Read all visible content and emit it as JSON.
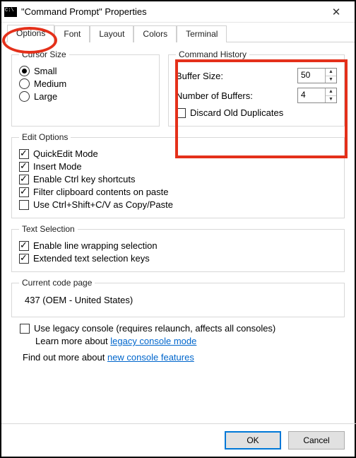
{
  "window": {
    "title": "\"Command Prompt\" Properties"
  },
  "tabs": {
    "options": "Options",
    "font": "Font",
    "layout": "Layout",
    "colors": "Colors",
    "terminal": "Terminal"
  },
  "cursor": {
    "legend": "Cursor Size",
    "small": "Small",
    "medium": "Medium",
    "large": "Large"
  },
  "history": {
    "legend": "Command History",
    "buffer_label": "Buffer Size:",
    "buffer_value": "50",
    "numbuf_label": "Number of Buffers:",
    "numbuf_value": "4",
    "discard_label": "Discard Old Duplicates"
  },
  "edit": {
    "legend": "Edit Options",
    "quickedit": "QuickEdit Mode",
    "insert": "Insert Mode",
    "ctrlkeys": "Enable Ctrl key shortcuts",
    "filter": "Filter clipboard contents on paste",
    "ctrlshift": "Use Ctrl+Shift+C/V as Copy/Paste"
  },
  "textsel": {
    "legend": "Text Selection",
    "wrap": "Enable line wrapping selection",
    "extended": "Extended text selection keys"
  },
  "codepage": {
    "legend": "Current code page",
    "value": "437   (OEM - United States)"
  },
  "legacy": {
    "checkbox": "Use legacy console (requires relaunch, affects all consoles)",
    "learn_prefix": "Learn more about ",
    "learn_link": "legacy console mode"
  },
  "footer": {
    "find_prefix": "Find out more about ",
    "find_link": "new console features"
  },
  "buttons": {
    "ok": "OK",
    "cancel": "Cancel"
  }
}
